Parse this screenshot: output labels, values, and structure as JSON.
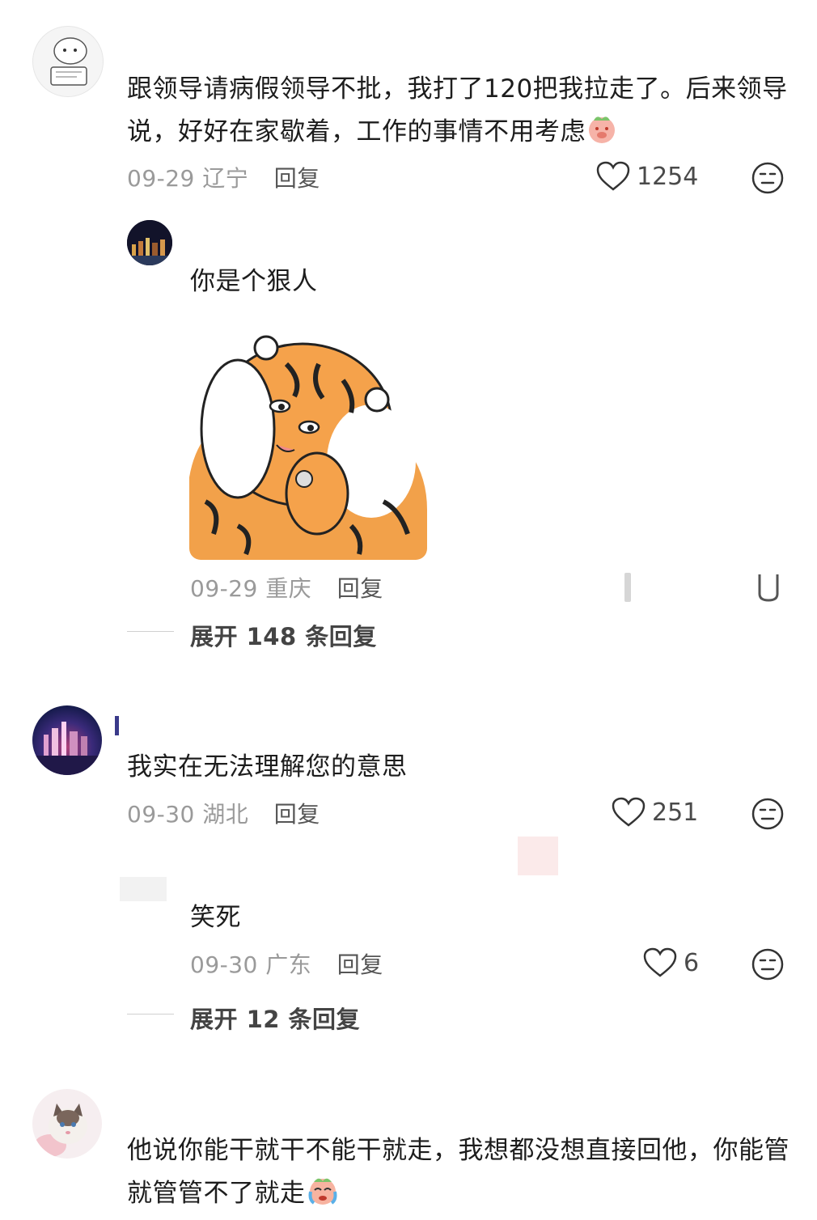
{
  "comments": [
    {
      "avatar_icon": "cartoon-bear-avatar",
      "text": "跟领导请病假领导不批，我打了120把我拉走了。后来领导说，好好在家歇着，工作的事情不用考虑",
      "emoji": "pig-emoji",
      "date": "09-29",
      "location": "辽宁",
      "reply_label": "回复",
      "likes": "1254",
      "replies": [
        {
          "avatar_icon": "night-city-avatar",
          "text": "你是个狠人",
          "sticker": "tiger-sticker",
          "date": "09-29",
          "location": "重庆",
          "reply_label": "回复"
        }
      ],
      "expand_label": "展开 148 条回复"
    },
    {
      "avatar_icon": "night-skyline-avatar",
      "text": "我实在无法理解您的意思",
      "date": "09-30",
      "location": "湖北",
      "reply_label": "回复",
      "likes": "251",
      "replies": [
        {
          "avatar_icon": "blank-avatar",
          "text": "笑死",
          "date": "09-30",
          "location": "广东",
          "reply_label": "回复",
          "likes": "6"
        }
      ],
      "expand_label": "展开 12 条回复"
    },
    {
      "avatar_icon": "cat-avatar",
      "text": "他说你能干就干不能干就走，我想都没想直接回他，你能管就管管不了就走",
      "emoji": "crying-face-emoji"
    }
  ],
  "colors": {
    "text": "#1d1d1d",
    "meta": "#9a9a9a",
    "reply": "#555555"
  }
}
